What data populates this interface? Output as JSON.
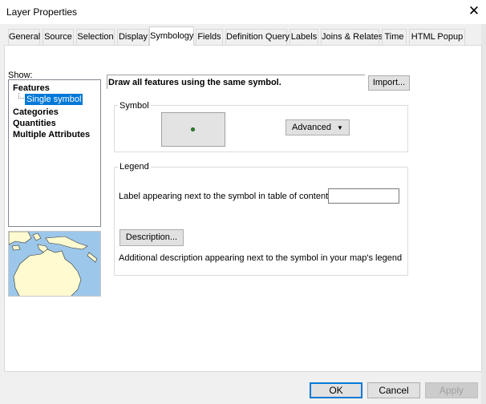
{
  "window": {
    "title": "Layer Properties",
    "close_glyph": "✕"
  },
  "tabs": [
    {
      "label": "General"
    },
    {
      "label": "Source"
    },
    {
      "label": "Selection"
    },
    {
      "label": "Display"
    },
    {
      "label": "Symbology",
      "active": true
    },
    {
      "label": "Fields"
    },
    {
      "label": "Definition Query"
    },
    {
      "label": "Labels"
    },
    {
      "label": "Joins & Relates"
    },
    {
      "label": "Time"
    },
    {
      "label": "HTML Popup"
    }
  ],
  "show": {
    "label": "Show:",
    "items": [
      {
        "label": "Features"
      },
      {
        "label": "Single symbol",
        "selected": true
      },
      {
        "label": "Categories"
      },
      {
        "label": "Quantities"
      },
      {
        "label": "Multiple Attributes"
      }
    ]
  },
  "symbology": {
    "description": "Draw all features using the same symbol.",
    "import_label": "Import...",
    "symbol_group": "Symbol",
    "advanced_label": "Advanced",
    "symbol_color": "#2a8a2a"
  },
  "legend": {
    "group_title": "Legend",
    "label_prompt": "Label appearing next to the symbol in table of contents:",
    "label_value": "",
    "description_button": "Description...",
    "description_text": "Additional description appearing next to the symbol in your map's legend"
  },
  "footer": {
    "ok_label": "OK",
    "cancel_label": "Cancel",
    "apply_label": "Apply"
  }
}
